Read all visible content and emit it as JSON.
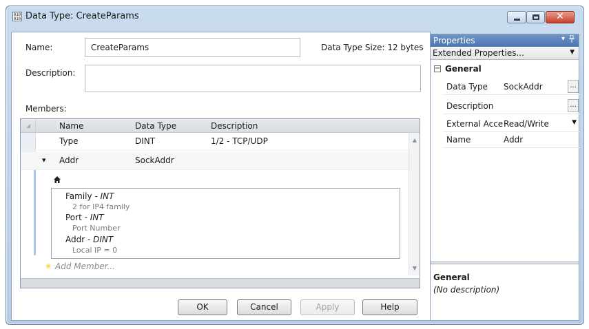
{
  "window": {
    "title": "Data Type: CreateParams",
    "icon_label": "010 010",
    "controls": {
      "minimize": "minimize-icon",
      "maximize": "maximize-icon",
      "close": "✕"
    }
  },
  "form": {
    "name_label": "Name:",
    "name_value": "CreateParams",
    "size_label": "Data Type Size: 12 bytes",
    "description_label": "Description:",
    "description_value": "",
    "members_label": "Members:"
  },
  "grid": {
    "columns": [
      "Name",
      "Data Type",
      "Description"
    ],
    "rows": [
      {
        "name": "Type",
        "data_type": "DINT",
        "description": "1/2 - TCP/UDP"
      },
      {
        "name": "Addr",
        "data_type": "SockAddr",
        "description": ""
      }
    ],
    "expand_glyph": "▾",
    "home_icon": "home-icon",
    "sub_members": [
      {
        "name": "Family",
        "type": "INT",
        "desc": "2 for IP4 family"
      },
      {
        "name": "Port",
        "type": "INT",
        "desc": "Port Number"
      },
      {
        "name": "Addr",
        "type": "DINT",
        "desc": "Local IP = 0"
      }
    ],
    "add_member": "Add Member...",
    "add_star": "✳"
  },
  "buttons": {
    "ok": "OK",
    "cancel": "Cancel",
    "apply": "Apply",
    "help": "Help"
  },
  "properties": {
    "title": "Properties",
    "pin_glyph": "ᵖ",
    "dropdown_glyph": "▾",
    "selector": "Extended Properties...",
    "category": "General",
    "category_toggle": "−",
    "rows": [
      {
        "key": "Data Type",
        "value": "SockAddr",
        "button": "..."
      },
      {
        "key": "Description",
        "value": "",
        "button": "..."
      },
      {
        "key": "External Access",
        "value": "Read/Write",
        "button": "▼"
      },
      {
        "key": "Name",
        "value": "Addr",
        "button": ""
      }
    ],
    "help_title": "General",
    "help_text": "(No description)"
  }
}
